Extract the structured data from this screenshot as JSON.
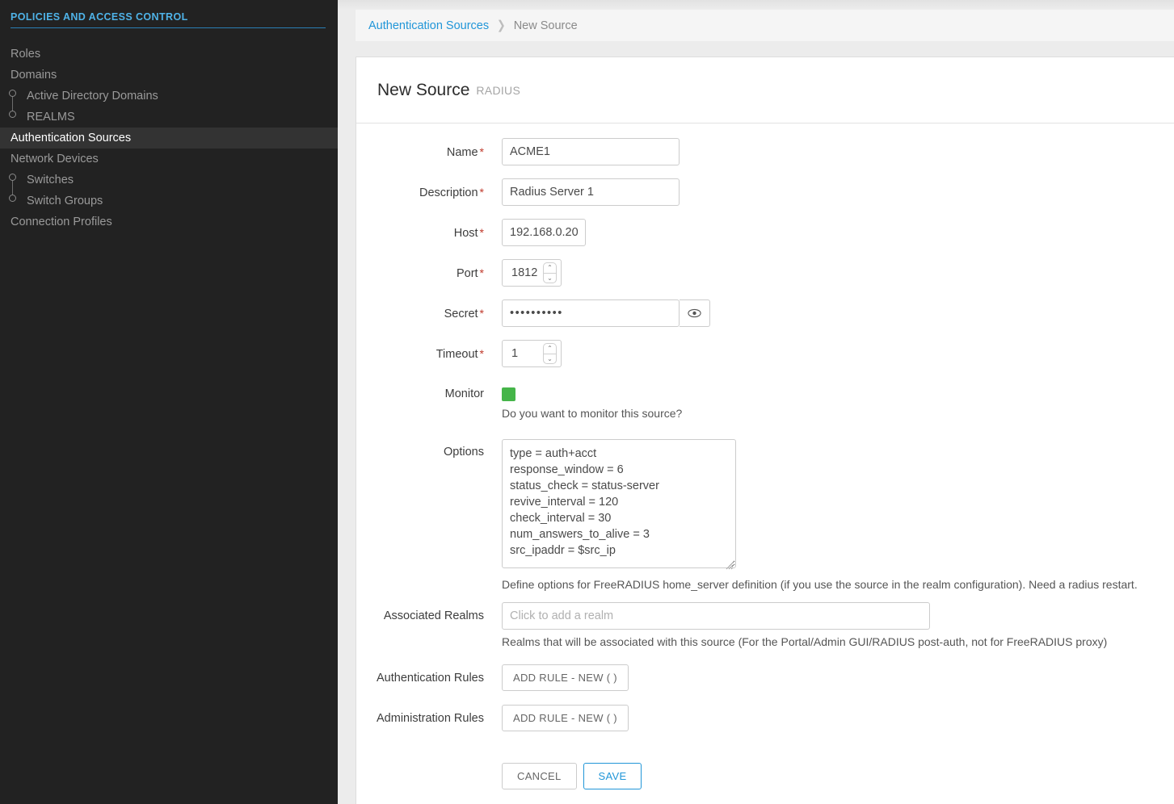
{
  "sidebar": {
    "header": "POLICIES AND ACCESS CONTROL",
    "items": [
      {
        "label": "Roles",
        "level": 0,
        "active": false
      },
      {
        "label": "Domains",
        "level": 0,
        "active": false
      },
      {
        "label": "Active Directory Domains",
        "level": 1,
        "active": false
      },
      {
        "label": "REALMS",
        "level": 1,
        "active": false
      },
      {
        "label": "Authentication Sources",
        "level": 0,
        "active": true
      },
      {
        "label": "Network Devices",
        "level": 0,
        "active": false
      },
      {
        "label": "Switches",
        "level": 1,
        "active": false
      },
      {
        "label": "Switch Groups",
        "level": 1,
        "active": false
      },
      {
        "label": "Connection Profiles",
        "level": 0,
        "active": false
      }
    ]
  },
  "breadcrumb": {
    "parent": "Authentication Sources",
    "separator": "❯",
    "current": "New Source"
  },
  "card": {
    "title": "New Source",
    "subtitle": "RADIUS"
  },
  "form": {
    "name": {
      "label": "Name",
      "required": "*",
      "value": "ACME1"
    },
    "description": {
      "label": "Description",
      "required": "*",
      "value": "Radius Server 1"
    },
    "host": {
      "label": "Host",
      "required": "*",
      "value": "192.168.0.20"
    },
    "port": {
      "label": "Port",
      "required": "*",
      "value": "1812"
    },
    "secret": {
      "label": "Secret",
      "required": "*",
      "value": "••••••••••",
      "toggle_icon": "eye-icon"
    },
    "timeout": {
      "label": "Timeout",
      "required": "*",
      "value": "1"
    },
    "monitor": {
      "label": "Monitor",
      "state": "on",
      "color": "#45b549",
      "help": "Do you want to monitor this source?"
    },
    "options": {
      "label": "Options",
      "value": "type = auth+acct\nresponse_window = 6\nstatus_check = status-server\nrevive_interval = 120\ncheck_interval = 30\nnum_answers_to_alive = 3\nsrc_ipaddr = $src_ip",
      "help": "Define options for FreeRADIUS home_server definition (if you use the source in the realm configuration). Need a radius restart."
    },
    "associated_realms": {
      "label": "Associated Realms",
      "value": "",
      "placeholder": "Click to add a realm",
      "help": "Realms that will be associated with this source (For the Portal/Admin GUI/RADIUS post-auth, not for FreeRADIUS proxy)"
    },
    "authentication_rules": {
      "label": "Authentication Rules",
      "button": "ADD RULE - NEW ( )"
    },
    "administration_rules": {
      "label": "Administration Rules",
      "button": "ADD RULE - NEW ( )"
    }
  },
  "actions": {
    "cancel": "CANCEL",
    "save": "SAVE"
  },
  "colors": {
    "accent": "#2196d8",
    "sidebar_bg": "#222222",
    "sidebar_active_bg": "#333333",
    "sidebar_header": "#4fb3e8",
    "required": "#c0392b",
    "toggle_on": "#45b549"
  },
  "spinner": {
    "up": "⌃",
    "down": "⌄"
  }
}
